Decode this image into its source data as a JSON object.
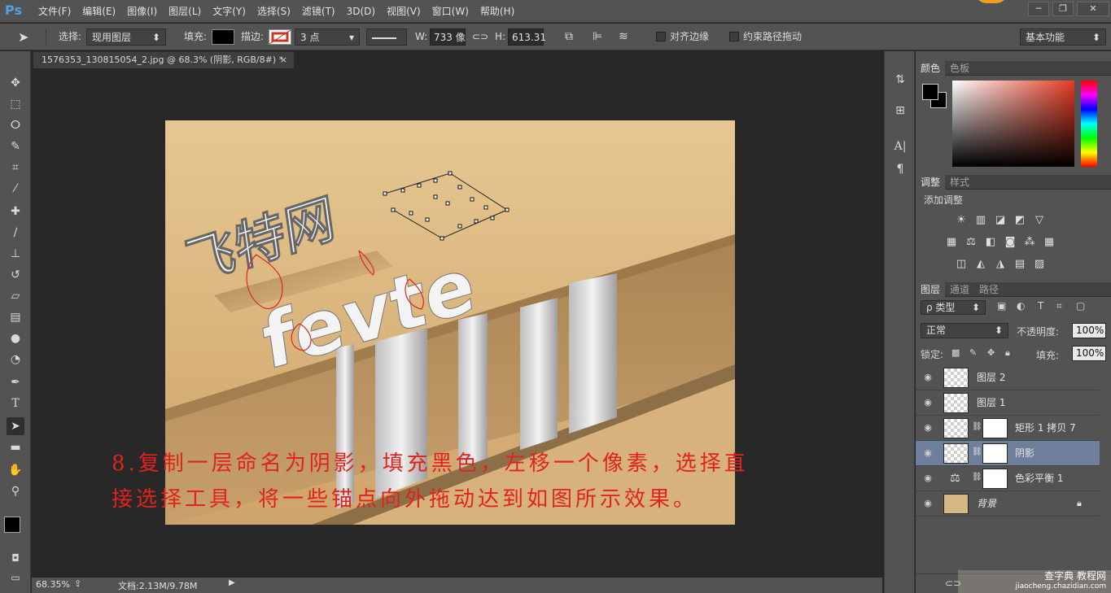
{
  "app": {
    "logo": "Ps"
  },
  "menubar": {
    "items": [
      "文件(F)",
      "编辑(E)",
      "图像(I)",
      "图层(L)",
      "文字(Y)",
      "选择(S)",
      "滤镜(T)",
      "3D(D)",
      "视图(V)",
      "窗口(W)",
      "帮助(H)"
    ]
  },
  "window_controls": {
    "minimize": "─",
    "restore": "❐",
    "close": "✕"
  },
  "options": {
    "select_label": "选择:",
    "select_value": "现用图层",
    "fill_label": "填充:",
    "stroke_label": "描边:",
    "stroke_width": "3 点",
    "w_label": "W:",
    "w_value": "733 像",
    "h_label": "H:",
    "h_value": "613.31",
    "align_edges": "对齐边缘",
    "constrain_path": "约束路径拖动",
    "workspace": "基本功能"
  },
  "document": {
    "tab_title": "1576353_130815054_2.jpg @ 68.3% (阴影, RGB/8#) *",
    "tab_close": "×",
    "zoom": "68.35%",
    "doc_size": "文档:2.13M/9.78M"
  },
  "artwork": {
    "chinese_text": "飞特网",
    "latin_text": "fevte",
    "annotation_line1": "8.复制一层命名为阴影，填充黑色，左移一个像素，选择直",
    "annotation_line2": "接选择工具，将一些锚点向外拖动达到如图所示效果。"
  },
  "color_panel": {
    "tabs": [
      "颜色",
      "色板"
    ]
  },
  "adjust_panel": {
    "tabs": [
      "调整",
      "样式"
    ],
    "heading": "添加调整"
  },
  "layers_panel": {
    "tabs": [
      "图层",
      "通道",
      "路径"
    ],
    "filter_kind": "ρ 类型",
    "blend_mode": "正常",
    "opacity_label": "不透明度:",
    "opacity_value": "100%",
    "lock_label": "锁定:",
    "fill_label": "填充:",
    "fill_value": "100%",
    "layers": [
      {
        "name": "图层 2",
        "selected": false
      },
      {
        "name": "图层 1",
        "selected": false
      },
      {
        "name": "矩形 1 拷贝 7",
        "selected": false
      },
      {
        "name": "阴影",
        "selected": true
      },
      {
        "name": "色彩平衡 1",
        "selected": false
      },
      {
        "name": "背景",
        "selected": false
      }
    ]
  },
  "watermark": {
    "line1": "查字典 教程网",
    "line2": "jiaocheng.chazidian.com"
  },
  "colors": {
    "selected_layer": "#6e7f9c",
    "annotation": "#e0231c",
    "ps_blue": "#4fa3e0"
  }
}
